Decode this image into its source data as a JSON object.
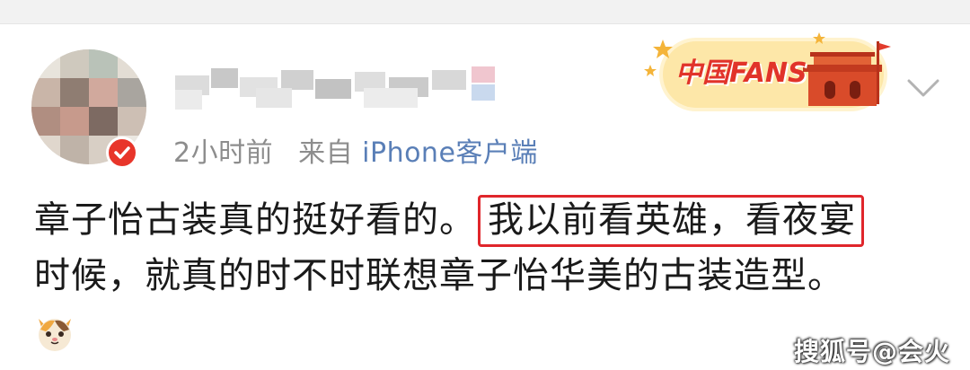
{
  "post": {
    "meta_time": "2小时前",
    "meta_source_prefix": "来自",
    "meta_source": "iPhone客户端",
    "text_before": "章子怡古装真的挺好看的。",
    "text_highlight": "我以前看英雄，看夜宴",
    "text_after": "时候，就真的时不时联想章子怡华美的古装造型。"
  },
  "header": {
    "fans_badge_text": "中国FANS"
  },
  "watermark": "搜狐号@会火",
  "icons": {
    "avatar": "avatar-pixelated",
    "badge": "verified-badge-icon",
    "fans": "china-fans-badge-icon",
    "menu": "chevron-down-icon",
    "emoji": "cat-face-emoji-icon"
  },
  "colors": {
    "highlight_border": "#e0262b",
    "source_link": "#5a7fb7",
    "meta_gray": "#8d8d8d"
  }
}
